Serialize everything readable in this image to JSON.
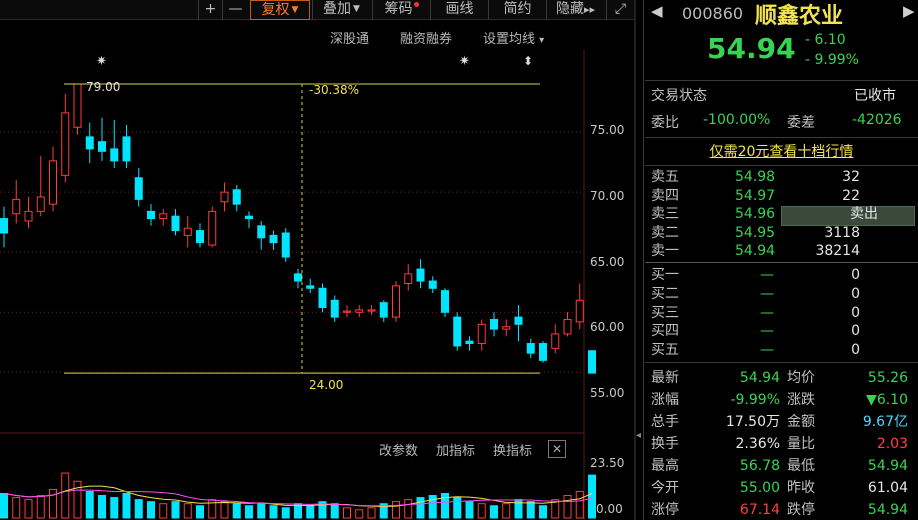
{
  "toolbar": {
    "plus": "+",
    "minus": "—",
    "fuquan": "复权",
    "diejia": "叠加",
    "chouma": "筹码",
    "huaxian": "画线",
    "jianyue": "简约",
    "yincang": "隐藏",
    "arrows": "▸▸",
    "expand": "⤢"
  },
  "chart_menu": {
    "shengutong": "深股通",
    "rongzi": "融资融券",
    "set_ma": "设置均线",
    "set_ma_caret": "▾"
  },
  "indicator_menu": {
    "params": "改参数",
    "add_indicator": "加指标",
    "switch_indicator": "换指标",
    "close": "✕"
  },
  "chart_data": {
    "type": "candlestick",
    "y_ticks": [
      "75.00",
      "70.00",
      "65.00",
      "60.00",
      "55.00"
    ],
    "ylim": [
      53.2,
      80.5
    ],
    "high_label": "79.00",
    "low_label": "24.00",
    "pct_label": "-30.38%",
    "volume_ticks": [
      "23.50",
      "0.00"
    ],
    "candles": [
      {
        "o": 67.8,
        "c": 66.6,
        "h": 68.8,
        "l": 65.4
      },
      {
        "o": 68.2,
        "c": 69.4,
        "h": 71.0,
        "l": 67.4
      },
      {
        "o": 67.6,
        "c": 68.4,
        "h": 69.6,
        "l": 67.0
      },
      {
        "o": 68.4,
        "c": 69.6,
        "h": 73.0,
        "l": 68.0
      },
      {
        "o": 69.0,
        "c": 72.6,
        "h": 73.8,
        "l": 68.4
      },
      {
        "o": 71.4,
        "c": 76.6,
        "h": 78.2,
        "l": 70.8
      },
      {
        "o": 75.4,
        "c": 79.0,
        "h": 79.0,
        "l": 74.8
      },
      {
        "o": 74.6,
        "c": 73.6,
        "h": 75.8,
        "l": 72.4
      },
      {
        "o": 74.2,
        "c": 73.4,
        "h": 76.2,
        "l": 72.6
      },
      {
        "o": 73.6,
        "c": 72.6,
        "h": 76.0,
        "l": 72.0
      },
      {
        "o": 74.6,
        "c": 72.6,
        "h": 75.6,
        "l": 72.0
      },
      {
        "o": 71.2,
        "c": 69.4,
        "h": 72.0,
        "l": 68.8
      },
      {
        "o": 68.4,
        "c": 67.8,
        "h": 69.0,
        "l": 67.2
      },
      {
        "o": 67.8,
        "c": 68.2,
        "h": 68.6,
        "l": 67.2
      },
      {
        "o": 68.0,
        "c": 66.8,
        "h": 68.6,
        "l": 66.4
      },
      {
        "o": 66.4,
        "c": 67.0,
        "h": 68.0,
        "l": 65.4
      },
      {
        "o": 66.8,
        "c": 65.8,
        "h": 67.4,
        "l": 65.4
      },
      {
        "o": 65.6,
        "c": 68.4,
        "h": 68.8,
        "l": 65.4
      },
      {
        "o": 69.2,
        "c": 70.0,
        "h": 70.8,
        "l": 68.4
      },
      {
        "o": 70.2,
        "c": 69.0,
        "h": 70.6,
        "l": 68.4
      },
      {
        "o": 68.0,
        "c": 67.8,
        "h": 68.4,
        "l": 67.0
      },
      {
        "o": 67.2,
        "c": 66.2,
        "h": 67.6,
        "l": 65.2
      },
      {
        "o": 66.4,
        "c": 65.8,
        "h": 66.8,
        "l": 65.2
      },
      {
        "o": 66.6,
        "c": 64.6,
        "h": 67.0,
        "l": 64.2
      },
      {
        "o": 63.2,
        "c": 62.6,
        "h": 63.6,
        "l": 62.0
      },
      {
        "o": 62.2,
        "c": 62.0,
        "h": 62.8,
        "l": 61.6
      },
      {
        "o": 62.0,
        "c": 60.4,
        "h": 62.4,
        "l": 60.0
      },
      {
        "o": 61.0,
        "c": 59.6,
        "h": 61.4,
        "l": 59.2
      },
      {
        "o": 60.0,
        "c": 60.1,
        "h": 60.6,
        "l": 59.6
      },
      {
        "o": 60.0,
        "c": 60.2,
        "h": 60.6,
        "l": 59.6
      },
      {
        "o": 60.1,
        "c": 60.2,
        "h": 60.6,
        "l": 59.8
      },
      {
        "o": 60.8,
        "c": 59.6,
        "h": 61.0,
        "l": 59.2
      },
      {
        "o": 59.6,
        "c": 62.2,
        "h": 62.6,
        "l": 59.2
      },
      {
        "o": 62.4,
        "c": 63.2,
        "h": 64.0,
        "l": 61.8
      },
      {
        "o": 63.6,
        "c": 62.6,
        "h": 64.4,
        "l": 62.0
      },
      {
        "o": 62.6,
        "c": 62.0,
        "h": 63.0,
        "l": 61.6
      },
      {
        "o": 61.8,
        "c": 60.0,
        "h": 62.0,
        "l": 59.6
      },
      {
        "o": 59.6,
        "c": 57.2,
        "h": 60.0,
        "l": 56.8
      },
      {
        "o": 57.6,
        "c": 57.4,
        "h": 58.0,
        "l": 56.8
      },
      {
        "o": 57.4,
        "c": 59.0,
        "h": 59.4,
        "l": 56.8
      },
      {
        "o": 59.4,
        "c": 58.6,
        "h": 60.0,
        "l": 58.0
      },
      {
        "o": 58.6,
        "c": 58.8,
        "h": 59.4,
        "l": 58.0
      },
      {
        "o": 59.6,
        "c": 59.0,
        "h": 60.6,
        "l": 57.6
      },
      {
        "o": 57.4,
        "c": 56.6,
        "h": 57.8,
        "l": 56.2
      },
      {
        "o": 57.4,
        "c": 56.0,
        "h": 57.6,
        "l": 55.8
      },
      {
        "o": 57.0,
        "c": 58.2,
        "h": 59.0,
        "l": 56.6
      },
      {
        "o": 58.2,
        "c": 59.4,
        "h": 60.0,
        "l": 58.0
      },
      {
        "o": 59.2,
        "c": 61.0,
        "h": 62.4,
        "l": 58.6
      },
      {
        "o": 56.8,
        "c": 54.94,
        "h": 56.78,
        "l": 54.94
      }
    ],
    "volumes": [
      12,
      10,
      9,
      11,
      14,
      22,
      18,
      13,
      11,
      10,
      12,
      9,
      8,
      7,
      8,
      7,
      6,
      9,
      8,
      7,
      6,
      7,
      6,
      5,
      7,
      6,
      8,
      7,
      5,
      4,
      5,
      7,
      8,
      9,
      10,
      11,
      12,
      10,
      8,
      7,
      6,
      7,
      9,
      8,
      6,
      9,
      11,
      13,
      21
    ]
  },
  "quote": {
    "code": "000860",
    "name": "顺鑫农业",
    "price": "54.94",
    "change": "- 6.10",
    "change_pct": "- 9.99%",
    "trade_status_label": "交易状态",
    "trade_status": "已收市",
    "weibi_label": "委比",
    "weibi": "-100.00%",
    "weicha_label": "委差",
    "weicha": "-42026",
    "promo": "仅需20元查看十档行情",
    "sell": [
      {
        "label": "卖五",
        "price": "54.98",
        "vol": "32"
      },
      {
        "label": "卖四",
        "price": "54.97",
        "vol": "22"
      },
      {
        "label": "卖三",
        "price": "54.96",
        "vol": "卖出"
      },
      {
        "label": "卖二",
        "price": "54.95",
        "vol": "3118"
      },
      {
        "label": "卖一",
        "price": "54.94",
        "vol": "38214"
      }
    ],
    "buy": [
      {
        "label": "买一",
        "price": "—",
        "vol": "0"
      },
      {
        "label": "买二",
        "price": "—",
        "vol": "0"
      },
      {
        "label": "买三",
        "price": "—",
        "vol": "0"
      },
      {
        "label": "买四",
        "price": "—",
        "vol": "0"
      },
      {
        "label": "买五",
        "price": "—",
        "vol": "0"
      }
    ],
    "stats": [
      {
        "l1": "最新",
        "v1": "54.94",
        "c1": "green",
        "l2": "均价",
        "v2": "55.26",
        "c2": "green"
      },
      {
        "l1": "涨幅",
        "v1": "-9.99%",
        "c1": "green",
        "l2": "涨跌",
        "v2": "▼6.10",
        "c2": "green"
      },
      {
        "l1": "总手",
        "v1": "17.50万",
        "c1": "white",
        "l2": "金额",
        "v2": "9.67亿",
        "c2": "cyan"
      },
      {
        "l1": "换手",
        "v1": "2.36%",
        "c1": "white",
        "l2": "量比",
        "v2": "2.03",
        "c2": "red"
      },
      {
        "l1": "最高",
        "v1": "56.78",
        "c1": "green",
        "l2": "最低",
        "v2": "54.94",
        "c2": "green"
      },
      {
        "l1": "今开",
        "v1": "55.00",
        "c1": "green",
        "l2": "昨收",
        "v2": "61.04",
        "c2": "white"
      },
      {
        "l1": "涨停",
        "v1": "67.14",
        "c1": "red",
        "l2": "跌停",
        "v2": "54.94",
        "c2": "green"
      }
    ]
  }
}
